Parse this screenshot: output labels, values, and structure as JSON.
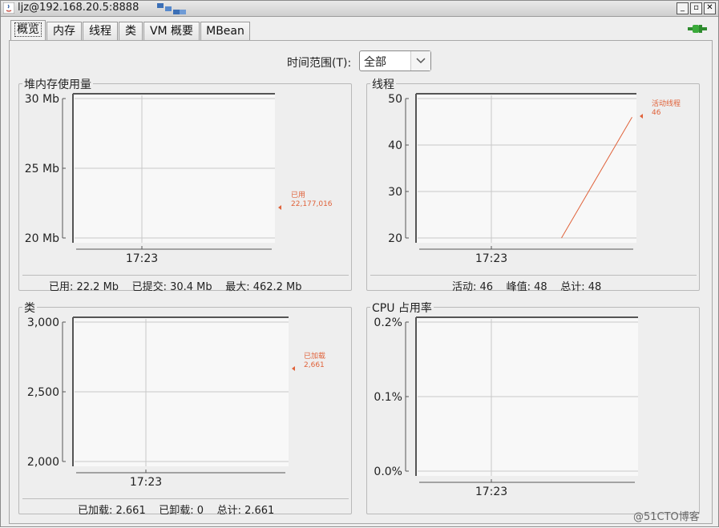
{
  "window": {
    "title": "ljz@192.168.20.5:8888",
    "buttons": {
      "minimize": "_",
      "restore": "▫",
      "close": "✕"
    }
  },
  "tabs": [
    {
      "label": "概览",
      "active": true
    },
    {
      "label": "内存",
      "active": false
    },
    {
      "label": "线程",
      "active": false
    },
    {
      "label": "类",
      "active": false
    },
    {
      "label": "VM 概要",
      "active": false
    },
    {
      "label": "MBean",
      "active": false
    }
  ],
  "time_range": {
    "label": "时间范围(T):",
    "value": "全部"
  },
  "panels": {
    "heap": {
      "title": "堆内存使用量",
      "stats": {
        "used": "已用: 22.2 Mb",
        "committed": "已提交: 30.4 Mb",
        "max": "最大: 462.2 Mb"
      }
    },
    "threads": {
      "title": "线程",
      "stats": {
        "live": "活动: 46",
        "peak": "峰值: 48",
        "total": "总计: 48"
      }
    },
    "classes": {
      "title": "类",
      "stats": {
        "loaded": "已加载: 2.661",
        "unloaded": "已卸载: 0",
        "total": "总计: 2.661"
      }
    },
    "cpu": {
      "title": "CPU 占用率",
      "stats": {}
    }
  },
  "chart_data": [
    {
      "type": "line",
      "title": "堆内存使用量",
      "y_ticks": [
        "30 Mb",
        "25 Mb",
        "20 Mb"
      ],
      "ylim": [
        20,
        30
      ],
      "x_ticks": [
        "17:23"
      ],
      "series": [
        {
          "name": "已用",
          "color": "#e0623a",
          "values": []
        }
      ],
      "legend": [
        {
          "label": "已用",
          "value": "22,177,016"
        }
      ]
    },
    {
      "type": "line",
      "title": "线程",
      "y_ticks": [
        "50",
        "40",
        "30",
        "20"
      ],
      "ylim": [
        20,
        50
      ],
      "x_ticks": [
        "17:23"
      ],
      "series": [
        {
          "name": "活动线程",
          "color": "#e0623a",
          "values": [
            20,
            46
          ]
        }
      ],
      "legend": [
        {
          "label": "活动线程",
          "value": "46"
        }
      ]
    },
    {
      "type": "line",
      "title": "类",
      "y_ticks": [
        "3,000",
        "2,500",
        "2,000"
      ],
      "ylim": [
        2000,
        3000
      ],
      "x_ticks": [
        "17:23"
      ],
      "series": [
        {
          "name": "已加载",
          "color": "#e0623a",
          "values": []
        }
      ],
      "legend": [
        {
          "label": "已加载",
          "value": "2,661"
        }
      ]
    },
    {
      "type": "line",
      "title": "CPU 占用率",
      "y_ticks": [
        "0.2%",
        "0.1%",
        "0.0%"
      ],
      "ylim": [
        0,
        0.2
      ],
      "x_ticks": [
        "17:23"
      ],
      "series": [],
      "legend": []
    }
  ],
  "watermark": "@51CTO博客",
  "colors": {
    "series": "#e0623a",
    "grid": "#c8c8c8",
    "axis": "#555555"
  }
}
